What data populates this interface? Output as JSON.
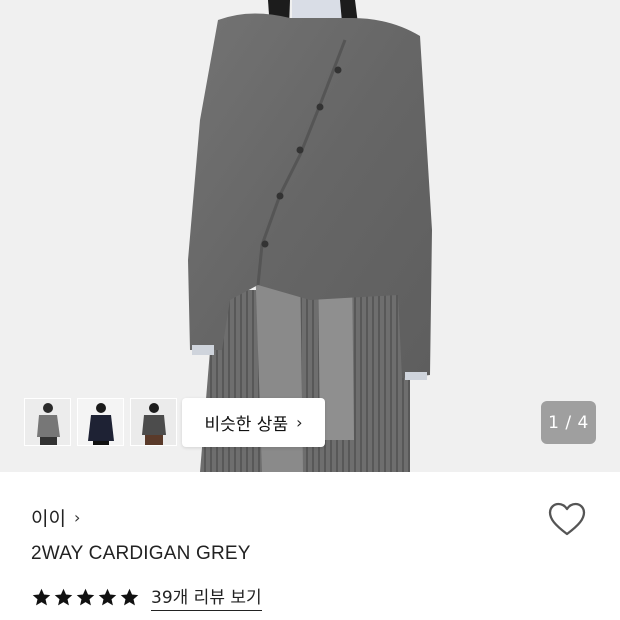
{
  "gallery": {
    "similar_label": "비슷한 상품",
    "similar_chevron": "›",
    "counter": "1 / 4",
    "thumbnails": [
      "grey-look",
      "navy-look",
      "charcoal-look"
    ]
  },
  "product": {
    "brand": "이이",
    "brand_chevron": "›",
    "name": "2WAY CARDIGAN GREY",
    "rating_stars": 5,
    "reviews_link": "39개 리뷰 보기",
    "wishlisted": false
  },
  "icons": {
    "heart": "heart-outline-icon",
    "star": "star-filled-icon",
    "chevron": "chevron-right-icon"
  },
  "colors": {
    "background": "#ffffff",
    "photo_bg": "#f0f0f0",
    "cardigan": "#6b6b6b",
    "star": "#111111",
    "counter_bg": "#808080"
  }
}
